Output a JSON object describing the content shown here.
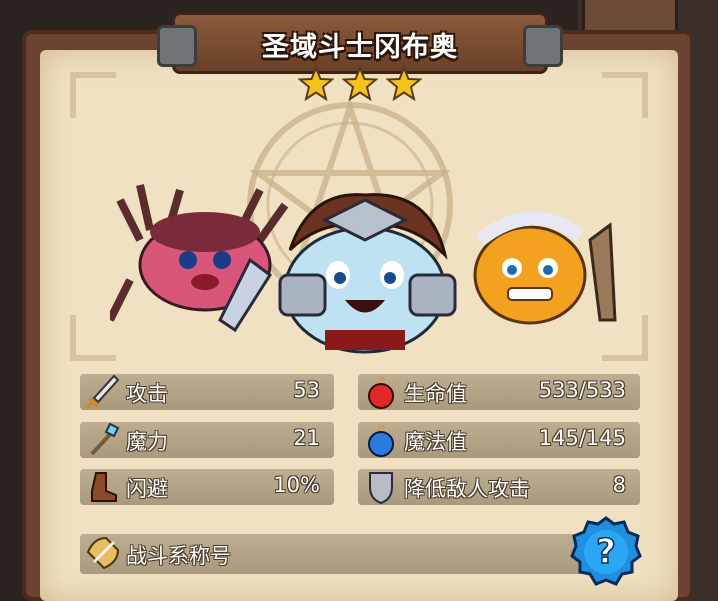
{
  "hero": {
    "name": "圣域斗士冈布奥",
    "stars": 3,
    "star_color": "#f6c31b"
  },
  "stats": [
    {
      "label": "攻击",
      "value": "53",
      "icon": "sword-icon"
    },
    {
      "label": "魔力",
      "value": "21",
      "icon": "staff-icon"
    },
    {
      "label": "闪避",
      "value": "10%",
      "icon": "boot-icon"
    },
    {
      "label": "生命值",
      "value": "533/533",
      "icon": "red-potion-icon"
    },
    {
      "label": "魔法值",
      "value": "145/145",
      "icon": "blue-potion-icon"
    },
    {
      "label": "降低敌人攻击",
      "value": "8",
      "icon": "shield-icon"
    }
  ],
  "combat_title": {
    "label": "战斗系称号",
    "icon": "badge-sword-icon"
  },
  "help": {
    "icon": "question-icon",
    "color": "#1f8fe0"
  }
}
